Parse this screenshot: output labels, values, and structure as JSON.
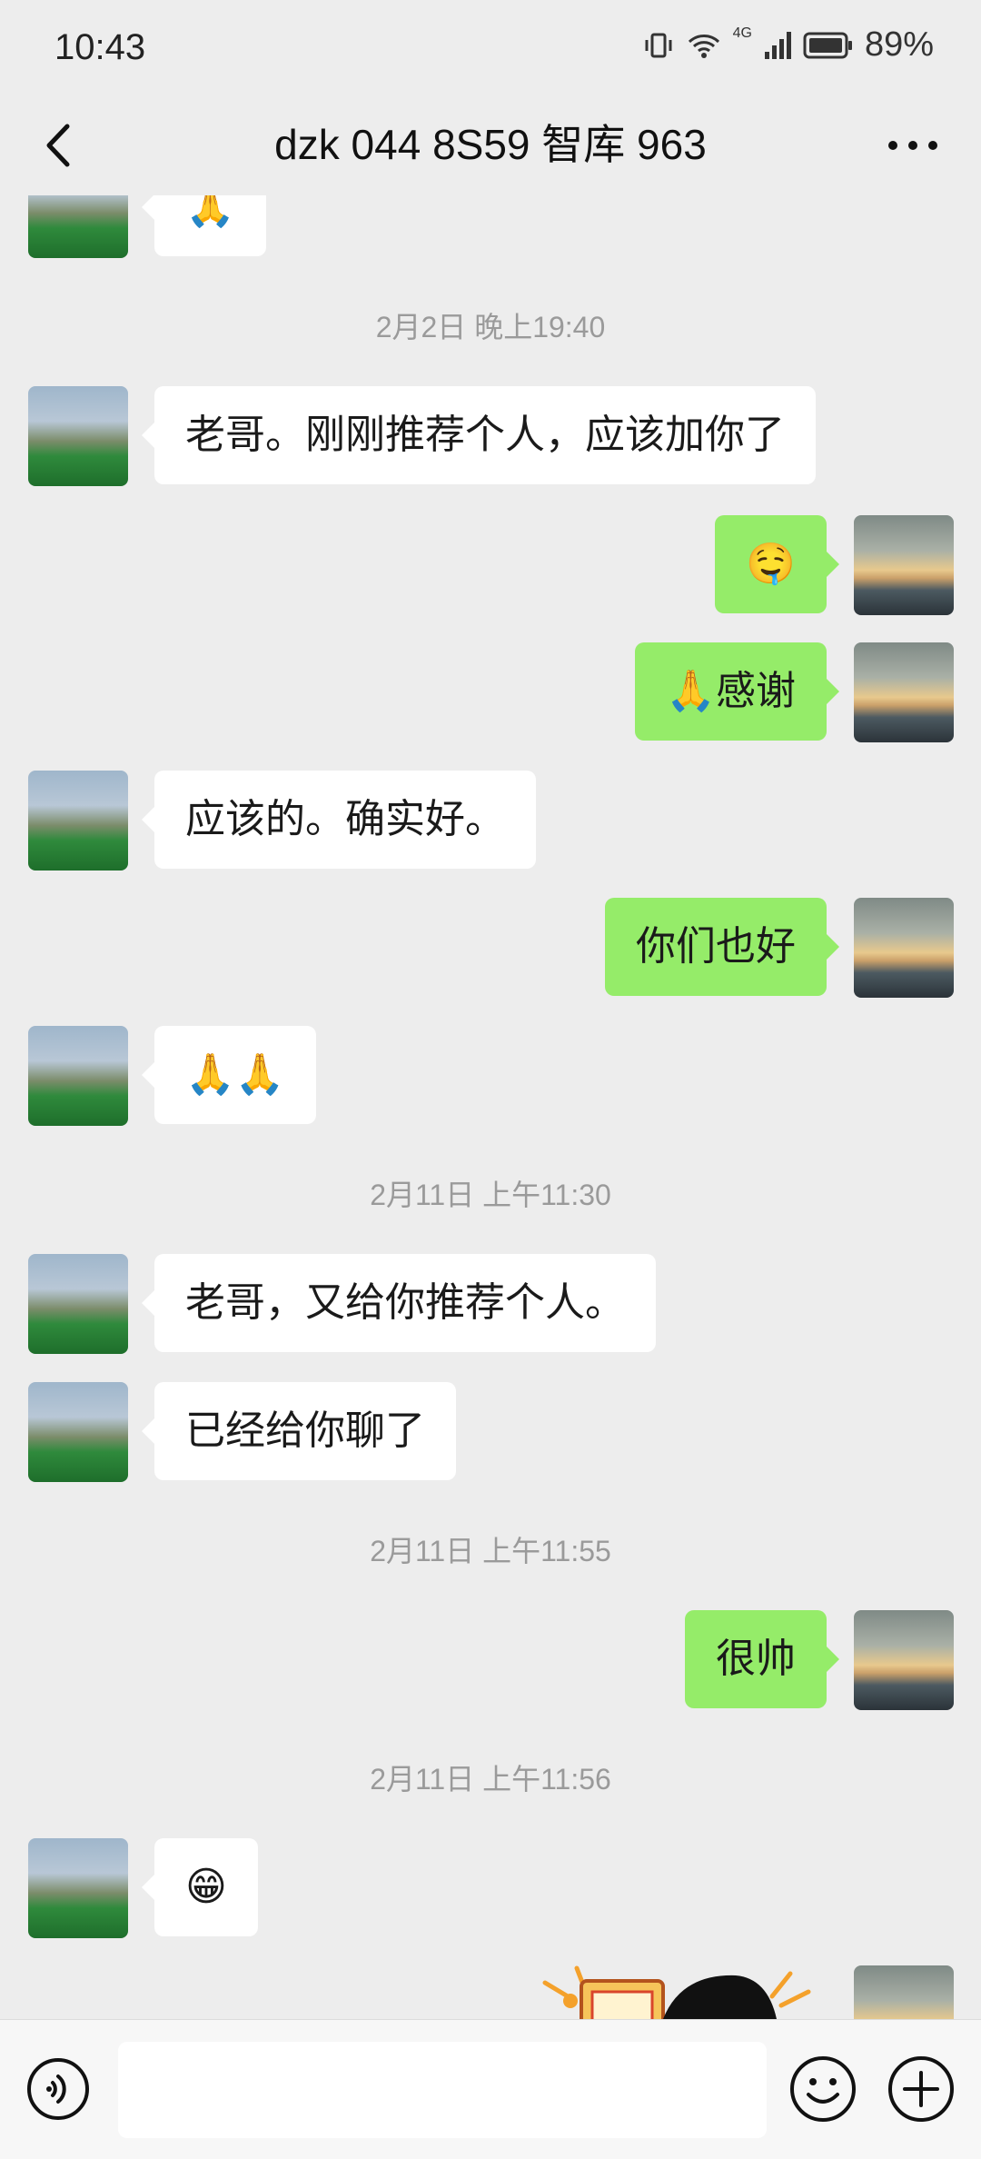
{
  "status_bar": {
    "time": "10:43",
    "network": "4G",
    "battery": "89%"
  },
  "header": {
    "title": "dzk 044 8S59 智库 963"
  },
  "messages": [
    {
      "kind": "left",
      "text": "🙏"
    },
    {
      "kind": "time",
      "text": "2月2日 晚上19:40"
    },
    {
      "kind": "left",
      "text": "老哥。刚刚推荐个人，应该加你了"
    },
    {
      "kind": "right",
      "text": "🤤"
    },
    {
      "kind": "right",
      "text": "🙏感谢"
    },
    {
      "kind": "left",
      "text": "应该的。确实好。"
    },
    {
      "kind": "right",
      "text": "你们也好"
    },
    {
      "kind": "left",
      "text": "🙏🙏"
    },
    {
      "kind": "time",
      "text": "2月11日 上午11:30"
    },
    {
      "kind": "left",
      "text": "老哥，又给你推荐个人。"
    },
    {
      "kind": "left",
      "text": "已经给你聊了"
    },
    {
      "kind": "time",
      "text": "2月11日 上午11:55"
    },
    {
      "kind": "right",
      "text": "很帅"
    },
    {
      "kind": "time",
      "text": "2月11日 上午11:56"
    },
    {
      "kind": "left",
      "text": "😁"
    },
    {
      "kind": "right",
      "text": "",
      "sticker": true
    }
  ],
  "input_bar": {
    "placeholder": ""
  },
  "colors": {
    "background": "#ededed",
    "outgoing_bubble": "#95ec69",
    "incoming_bubble": "#ffffff"
  }
}
